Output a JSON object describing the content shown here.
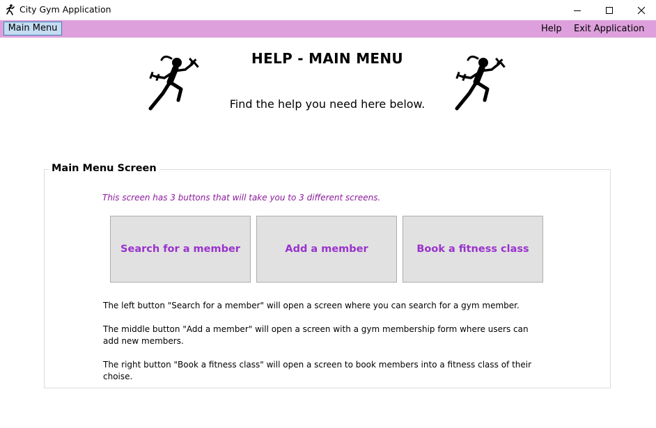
{
  "window": {
    "title": "City Gym Application",
    "app_icon": "runner-icon",
    "controls": [
      "minimize-icon",
      "maximize-icon",
      "close-icon"
    ]
  },
  "menubar": {
    "main_menu_label": "Main Menu",
    "help_label": "Help",
    "exit_label": "Exit Application",
    "background_color": "#dda0dd"
  },
  "header": {
    "title": "HELP - MAIN MENU",
    "subtitle": "Find the help you need here below.",
    "decoration_icon": "runner-with-dumbbells-icon"
  },
  "group": {
    "legend": "Main Menu Screen",
    "intro": "This screen has 3 buttons that will take you to 3 different screens.",
    "buttons": [
      {
        "label": "Search for a member"
      },
      {
        "label": "Add a member"
      },
      {
        "label": "Book a fitness class"
      }
    ],
    "descriptions": [
      "The left button \"Search for a member\" will open a screen where you can search for a gym member.",
      "The middle button \"Add a member\" will open a screen with a gym membership form where users can add new members.",
      "The right button \"Book a fitness class\" will open a screen to book members into a fitness class of their choise."
    ]
  },
  "colors": {
    "accent_text": "#9932cc",
    "intro_text": "#8b1a9b",
    "button_bg": "#e1e1e1"
  }
}
